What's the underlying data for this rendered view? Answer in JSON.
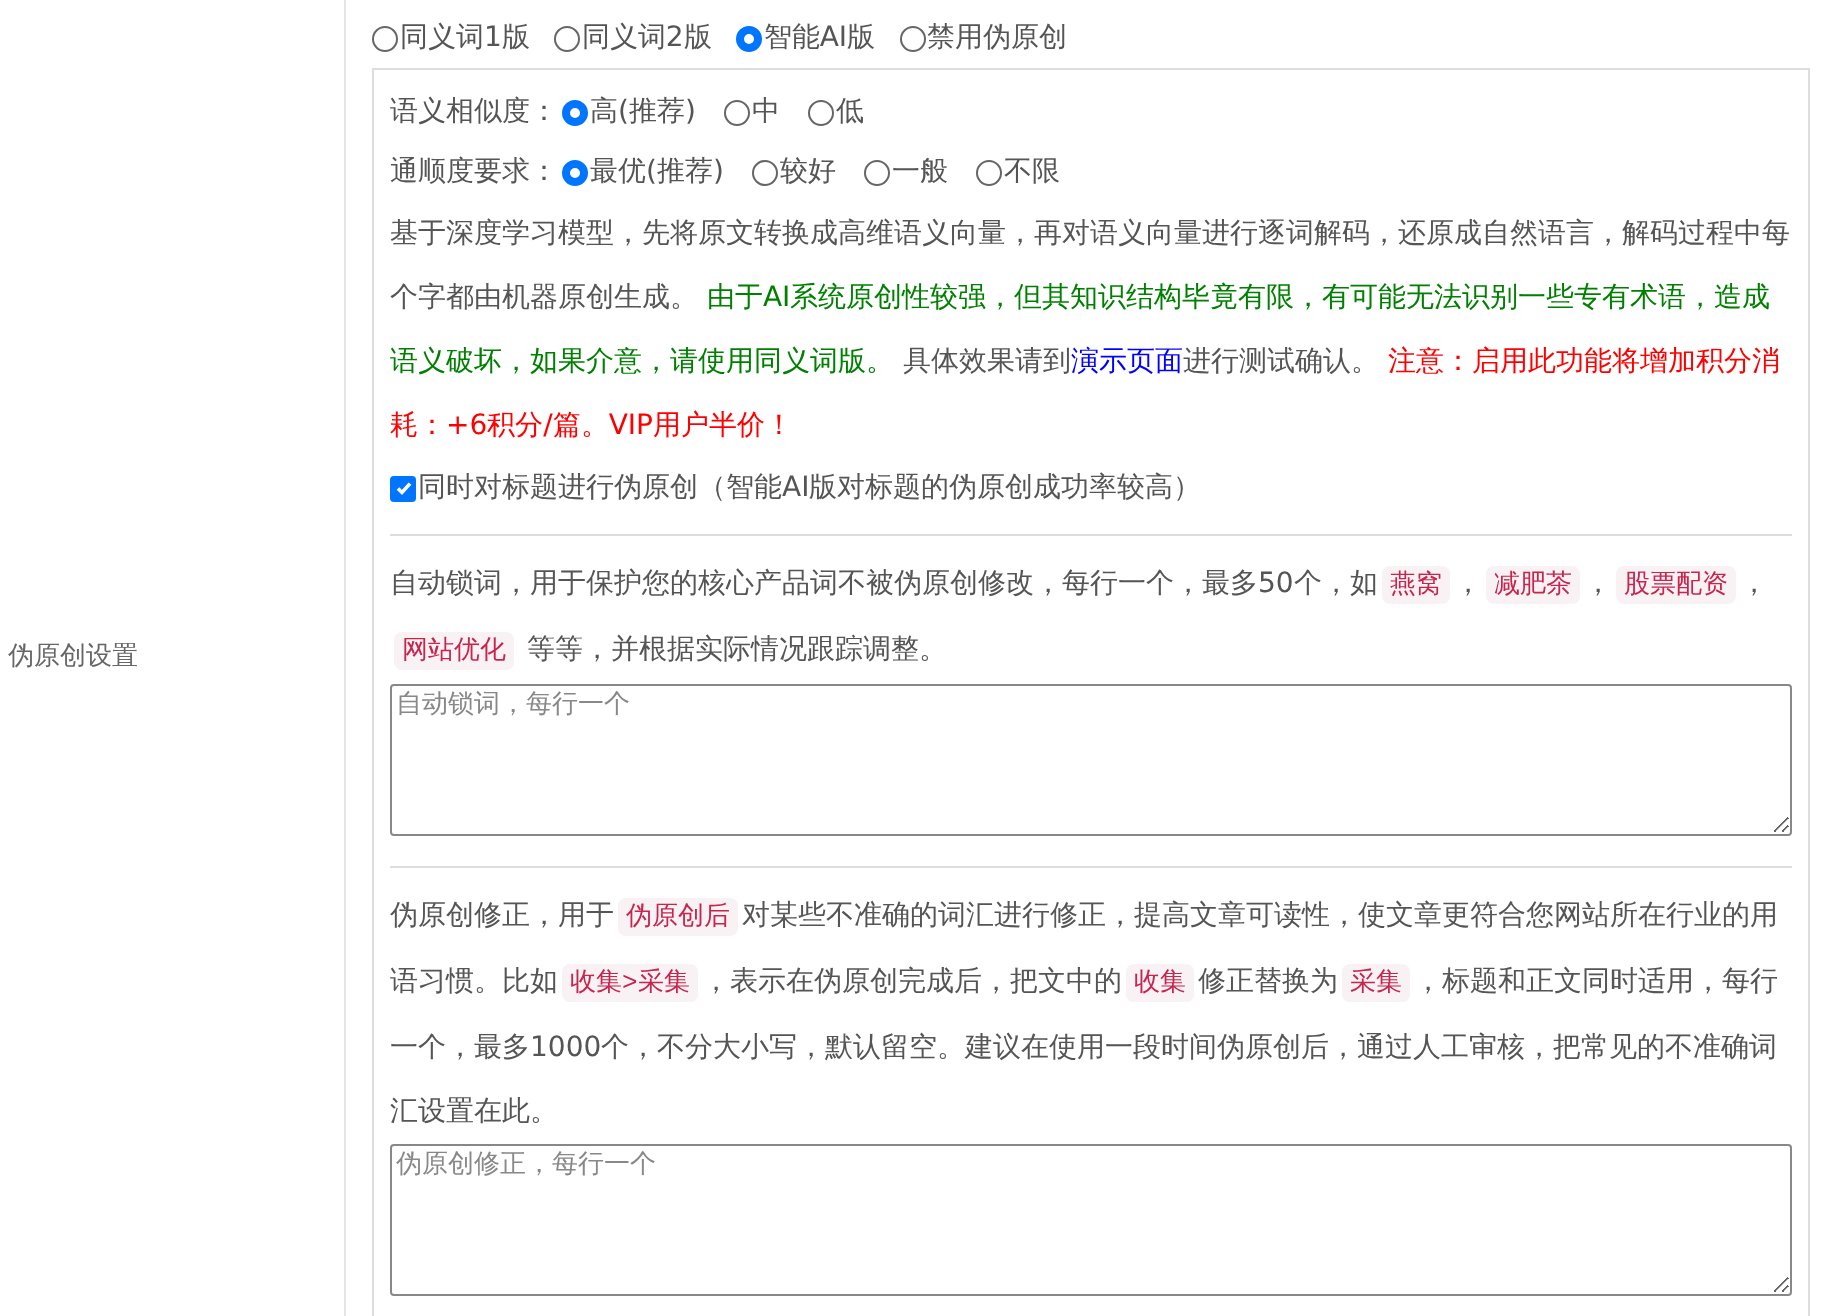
{
  "label": "伪原创设置",
  "modes": [
    {
      "label": "同义词1版",
      "selected": false
    },
    {
      "label": "同义词2版",
      "selected": false
    },
    {
      "label": "智能AI版",
      "selected": true
    },
    {
      "label": "禁用伪原创",
      "selected": false
    }
  ],
  "ai_panel": {
    "option_groups": [
      {
        "label": "语义相似度：",
        "options": [
          {
            "label": "高(推荐)",
            "selected": true
          },
          {
            "label": "中",
            "selected": false
          },
          {
            "label": "低",
            "selected": false
          }
        ]
      },
      {
        "label": "通顺度要求：",
        "options": [
          {
            "label": "最优(推荐)",
            "selected": true
          },
          {
            "label": "较好",
            "selected": false
          },
          {
            "label": "一般",
            "selected": false
          },
          {
            "label": "不限",
            "selected": false
          }
        ]
      }
    ],
    "description": [
      {
        "kind": "text",
        "text": "基于深度学习模型，先将原文转换成高维语义向量，再对语义向量进行逐词解码，还原成自然语言，解码过程中每个字都由机器原创生成。 "
      },
      {
        "kind": "notice",
        "text": "由于AI系统原创性较强，但其知识结构毕竟有限，有可能无法识别一些专有术语，造成语义破坏，如果介意，请使用同义词版。"
      },
      {
        "kind": "text",
        "text": " 具体效果请到"
      },
      {
        "kind": "link",
        "text": "演示页面"
      },
      {
        "kind": "text",
        "text": "进行测试确认。 "
      },
      {
        "kind": "warning",
        "text": "注意：启用此功能将增加积分消耗：+6积分/篇。VIP用户半价！"
      }
    ],
    "title_option": {
      "label": "同时对标题进行伪原创（智能AI版对标题的伪原创成功率较高）",
      "checked": true
    }
  },
  "lock_words": {
    "description": [
      {
        "kind": "text",
        "text": "自动锁词，用于保护您的核心产品词不被伪原创修改，每行一个，最多50个，如"
      },
      {
        "kind": "code",
        "text": "燕窝"
      },
      {
        "kind": "text",
        "text": "，"
      },
      {
        "kind": "code",
        "text": "减肥茶"
      },
      {
        "kind": "text",
        "text": "，"
      },
      {
        "kind": "code",
        "text": "股票配资"
      },
      {
        "kind": "text",
        "text": "，"
      },
      {
        "kind": "code",
        "text": "网站优化"
      },
      {
        "kind": "text",
        "text": " 等等，并根据实际情况跟踪调整。"
      }
    ],
    "placeholder": "自动锁词，每行一个"
  },
  "correction": {
    "description": [
      {
        "kind": "text",
        "text": "伪原创修正，用于"
      },
      {
        "kind": "code",
        "text": "伪原创后"
      },
      {
        "kind": "text",
        "text": "对某些不准确的词汇进行修正，提高文章可读性，使文章更符合您网站所在行业的用语习惯。比如"
      },
      {
        "kind": "code",
        "text": "收集>采集"
      },
      {
        "kind": "text",
        "text": "，表示在伪原创完成后，把文中的"
      },
      {
        "kind": "code",
        "text": "收集"
      },
      {
        "kind": "text",
        "text": "修正替换为"
      },
      {
        "kind": "code",
        "text": "采集"
      },
      {
        "kind": "text",
        "text": "，标题和正文同时适用，每行一个，最多1000个，不分大小写，默认留空。建议在使用一段时间伪原创后，通过人工审核，把常见的不准确词汇设置在此。"
      }
    ],
    "placeholder": "伪原创修正，每行一个"
  }
}
